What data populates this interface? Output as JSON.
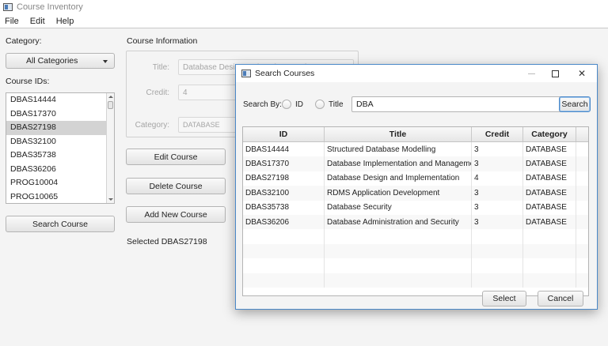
{
  "window": {
    "title": "Course Inventory"
  },
  "menu": [
    "File",
    "Edit",
    "Help"
  ],
  "left": {
    "category_label": "Category:",
    "category_value": "All Categories",
    "course_ids_label": "Course IDs:",
    "course_ids": [
      "DBAS14444",
      "DBAS17370",
      "DBAS27198",
      "DBAS32100",
      "DBAS35738",
      "DBAS36206",
      "PROG10004",
      "PROG10065"
    ],
    "selected_course_id": "DBAS27198",
    "search_button": "Search Course"
  },
  "info": {
    "heading": "Course Information",
    "title_label": "Title:",
    "title_value": "Database Design and Implementation",
    "credit_label": "Credit:",
    "credit_value": "4",
    "category_label": "Category:",
    "category_value": "DATABASE"
  },
  "actions": {
    "edit": "Edit Course",
    "delete": "Delete Course",
    "add": "Add New Course",
    "status": "Selected DBAS27198"
  },
  "dialog": {
    "title": "Search Courses",
    "search_by_label": "Search By:",
    "radio_id_label": "ID",
    "radio_title_label": "Title",
    "search_value": "DBA",
    "search_button": "Search",
    "columns": [
      "ID",
      "Title",
      "Credit",
      "Category"
    ],
    "rows": [
      [
        "DBAS14444",
        "Structured Database Modelling",
        "3",
        "DATABASE"
      ],
      [
        "DBAS17370",
        "Database Implementation and Management",
        "3",
        "DATABASE"
      ],
      [
        "DBAS27198",
        "Database Design and Implementation",
        "4",
        "DATABASE"
      ],
      [
        "DBAS32100",
        "RDMS Application Development",
        "3",
        "DATABASE"
      ],
      [
        "DBAS35738",
        "Database Security",
        "3",
        "DATABASE"
      ],
      [
        "DBAS36206",
        "Database Administration and Security",
        "3",
        "DATABASE"
      ]
    ],
    "select_button": "Select",
    "cancel_button": "Cancel"
  },
  "colors": {
    "dialog_border": "#4a88c8",
    "selection": "#d3d3d3"
  }
}
